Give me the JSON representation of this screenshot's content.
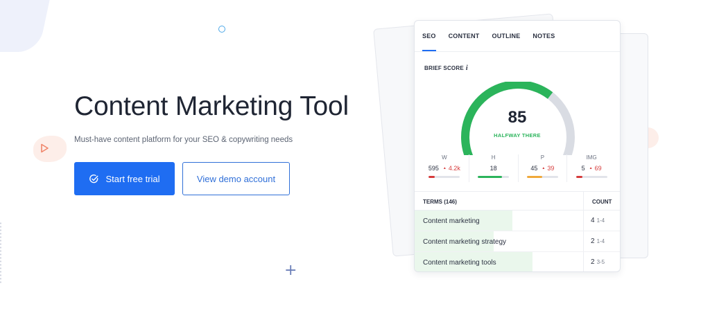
{
  "hero": {
    "title": "Content Marketing Tool",
    "subtitle": "Must-have content platform for your SEO & copywriting needs",
    "primary_button": "Start free trial",
    "secondary_button": "View demo account"
  },
  "card": {
    "tabs": [
      {
        "label": "SEO",
        "active": true
      },
      {
        "label": "CONTENT",
        "active": false
      },
      {
        "label": "OUTLINE",
        "active": false
      },
      {
        "label": "NOTES",
        "active": false
      }
    ],
    "brief_score_label": "BRIEF SCORE",
    "info_glyph": "i",
    "score": "85",
    "score_fraction": 0.64,
    "score_status": "HALFWAY THERE",
    "metrics": [
      {
        "label": "W",
        "value": "595",
        "target": "4.2k",
        "fill": 0.2,
        "color": "#d63b3b"
      },
      {
        "label": "H",
        "value": "18",
        "target": "",
        "fill": 0.78,
        "color": "#2bb45b"
      },
      {
        "label": "P",
        "value": "45",
        "target": "39",
        "fill": 0.5,
        "color": "#f0a93a"
      },
      {
        "label": "IMG",
        "value": "5",
        "target": "69",
        "fill": 0.2,
        "color": "#d63b3b"
      }
    ],
    "terms_header": "TERMS (146)",
    "count_header": "COUNT",
    "terms": [
      {
        "name": "Content marketing",
        "count": "4",
        "range": "1-4",
        "fill": 0.58
      },
      {
        "name": "Content marketing strategy",
        "count": "2",
        "range": "1-4",
        "fill": 0.47
      },
      {
        "name": "Content marketing tools",
        "count": "2",
        "range": "3-5",
        "fill": 0.7
      }
    ]
  },
  "colors": {
    "primary": "#1f6df2",
    "gauge_green": "#2bb45b",
    "gauge_track": "#d9dce3"
  }
}
